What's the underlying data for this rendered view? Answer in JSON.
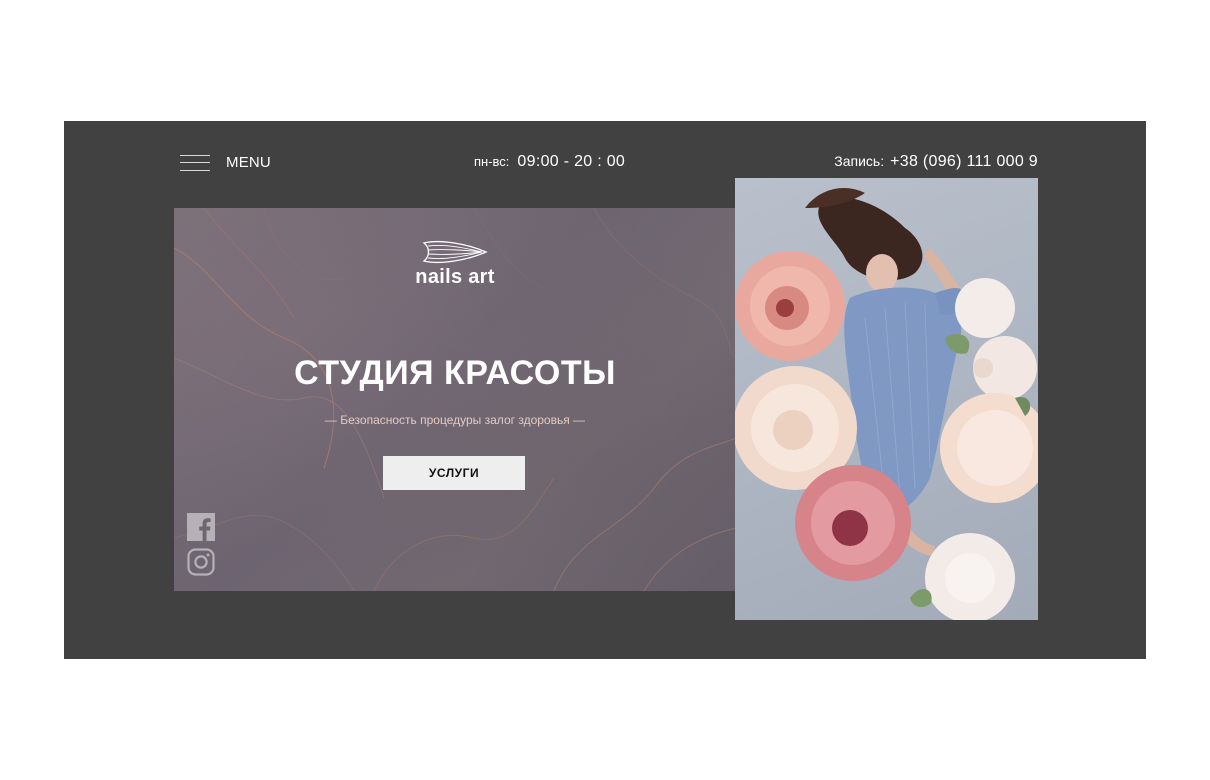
{
  "header": {
    "menu_label": "MENU",
    "hours_label": "пн-вс:",
    "hours_value": "09:00 - 20 : 00",
    "phone_label": "Запись:",
    "phone_value": "+38 (096) 111 000 9"
  },
  "hero": {
    "logo_text": "nails art",
    "title": "СТУДИЯ КРАСОТЫ",
    "subtitle": "— Безопасность процедуры залог здоровья —",
    "cta_label": "УСЛУГИ"
  },
  "social": {
    "items": [
      {
        "icon": "facebook-icon"
      },
      {
        "icon": "instagram-icon"
      }
    ]
  },
  "colors": {
    "frame_bg": "#414141",
    "hero_bg": "#6f6770",
    "cta_bg": "#eeeeee",
    "subtitle": "#e4c9c2"
  }
}
